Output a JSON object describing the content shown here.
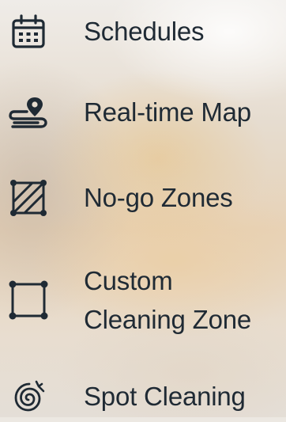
{
  "menu": {
    "items": [
      {
        "label": "Schedules",
        "icon": "calendar-icon"
      },
      {
        "label": "Real-time Map",
        "icon": "route-map-pin-icon"
      },
      {
        "label": "No-go Zones",
        "icon": "hatched-zone-icon"
      },
      {
        "label_line1": "Custom",
        "label_line2": "Cleaning Zone",
        "icon": "custom-zone-icon"
      },
      {
        "label": "Spot Cleaning",
        "icon": "spiral-icon"
      }
    ]
  },
  "colors": {
    "text": "#1f2a34",
    "icon": "#1f2a34"
  }
}
